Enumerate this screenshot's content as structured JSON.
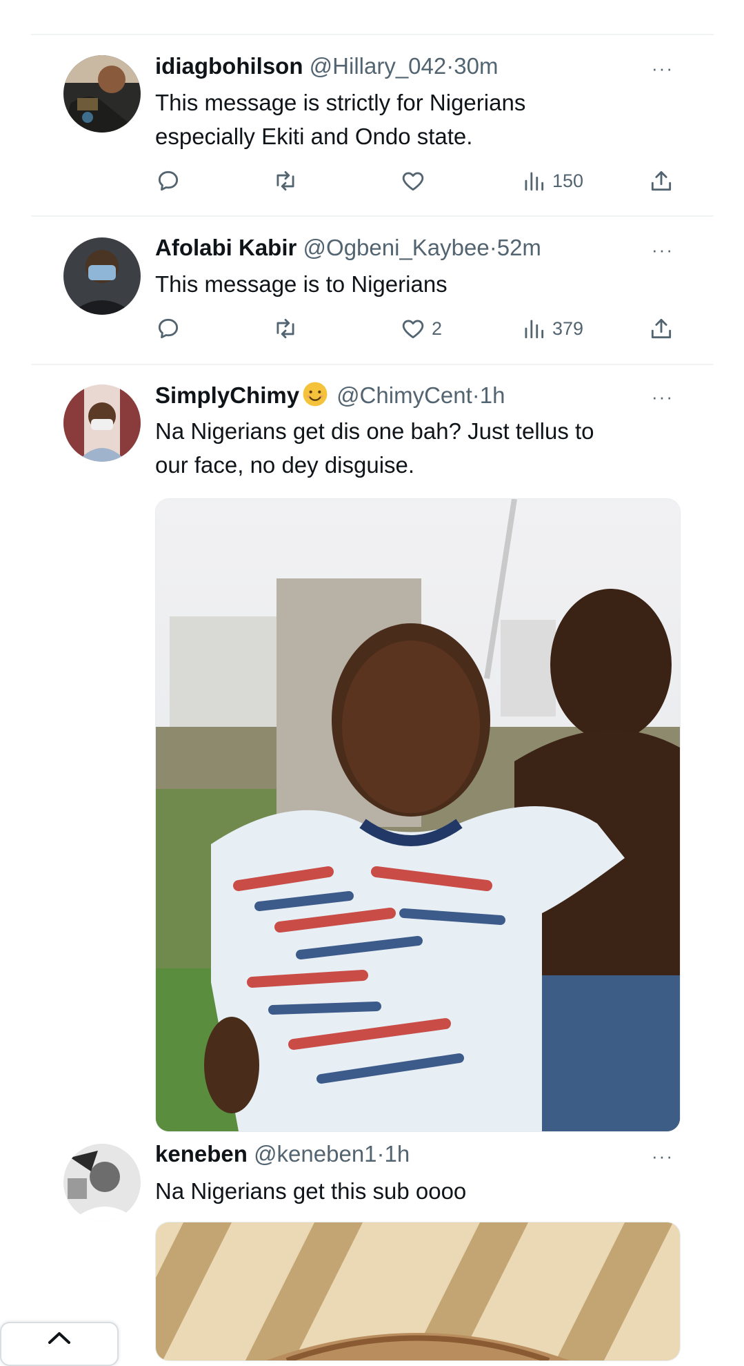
{
  "tweets": [
    {
      "name": "idiagbohilson",
      "handle": "@Hillary_042",
      "time": "30m",
      "text_lines": [
        "This message is strictly for Nigerians",
        "especially Ekiti and Ondo state."
      ],
      "likes": "",
      "views": "150"
    },
    {
      "name": "Afolabi Kabir",
      "handle": "@Ogbeni_Kaybee",
      "time": "52m",
      "text_lines": [
        "This message is to Nigerians"
      ],
      "likes": "2",
      "views": "379"
    },
    {
      "name": "SimplyChimy",
      "handle": "@ChimyCent",
      "time": "1h",
      "text_lines": [
        "Na Nigerians get dis one bah? Just tellus to",
        "our face, no dey disguise."
      ]
    },
    {
      "name": "keneben",
      "handle": "@keneben1",
      "time": "1h",
      "text_lines": [
        "Na Nigerians get this sub oooo"
      ]
    }
  ],
  "separator": "·",
  "more_label": "···",
  "icons": {
    "reply": "reply-icon",
    "retweet": "retweet-icon",
    "like": "heart-icon",
    "views": "views-icon",
    "share": "share-icon",
    "emoji": "smiling-face-emoji",
    "scroll_top": "chevron-up-icon"
  },
  "colors": {
    "text": "#0f1419",
    "muted": "#536471",
    "divider": "#eff3f4",
    "emoji": "#f5c33b"
  }
}
